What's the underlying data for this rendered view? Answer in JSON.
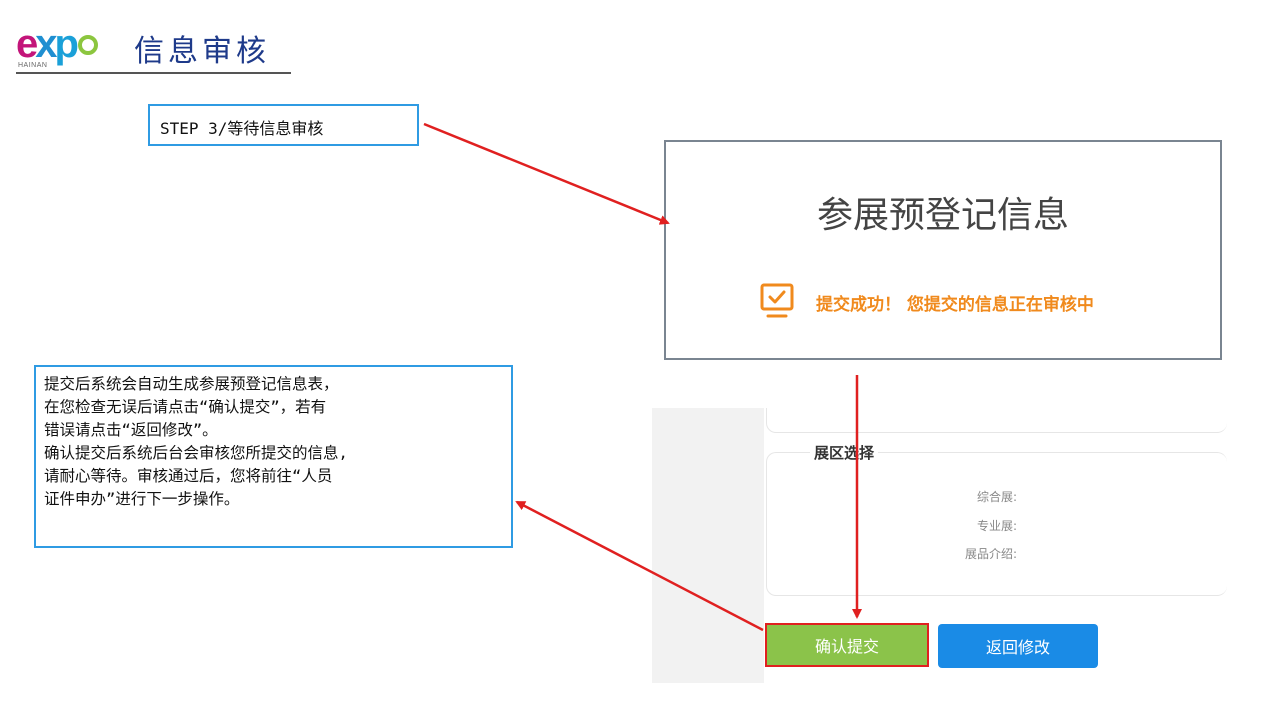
{
  "header": {
    "logo_text_e": "e",
    "logo_text_x": "x",
    "logo_text_p": "p",
    "logo_sub": "HAINAN",
    "title": "信息审核"
  },
  "step_callout": {
    "text": "STEP 3/等待信息审核"
  },
  "desc_callout": {
    "text": "提交后系统会自动生成参展预登记信息表，\n在您检查无误后请点击“确认提交”，若有\n错误请点击“返回修改”。\n确认提交后系统后台会审核您所提交的信息,\n请耐心等待。审核通过后，您将前往“人员\n证件申办”进行下一步操作。"
  },
  "result_panel": {
    "title": "参展预登记信息",
    "success_message": "提交成功！ 您提交的信息正在审核中",
    "icon": "monitor-check-icon"
  },
  "form": {
    "area_legend": "展区选择",
    "fields": [
      {
        "label": "综合展:"
      },
      {
        "label": "专业展:"
      },
      {
        "label": "展品介绍:"
      }
    ],
    "confirm_button": "确认提交",
    "back_button": "返回修改"
  },
  "colors": {
    "callout_border": "#2f9be3",
    "arrow": "#e02020",
    "success_orange": "#f08a1d",
    "confirm_green": "#8bc34a",
    "back_blue": "#1a8be6",
    "title_blue": "#1e3a8a"
  }
}
